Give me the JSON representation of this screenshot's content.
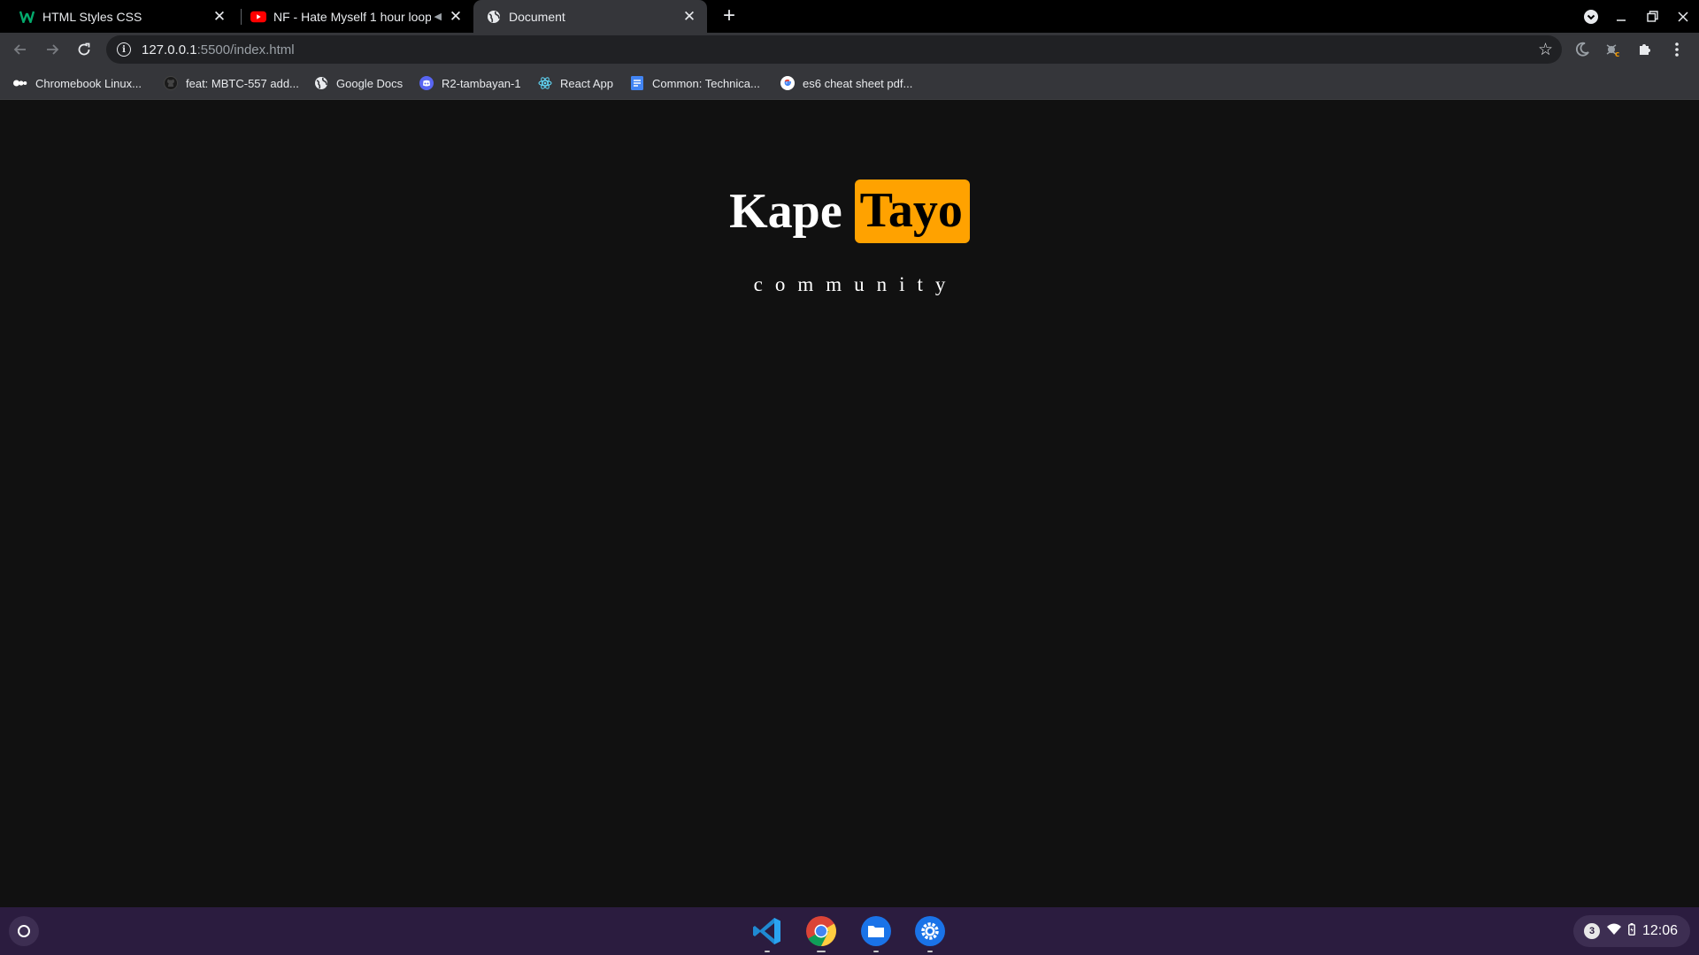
{
  "tabs": [
    {
      "title": "HTML Styles CSS",
      "favicon": "w3schools-icon",
      "active": false
    },
    {
      "title": "NF - Hate Myself 1 hour loop",
      "favicon": "youtube-icon",
      "active": false,
      "muted_indicator": "audio-icon"
    },
    {
      "title": "Document",
      "favicon": "globe-icon",
      "active": true
    }
  ],
  "toolbar": {
    "url_host": "127.0.0.1",
    "url_path": ":5500/index.html"
  },
  "bookmarks": [
    {
      "label": "Chromebook Linux...",
      "icon": "video-icon"
    },
    {
      "label": "feat: MBTC-557 add...",
      "icon": "github-icon"
    },
    {
      "label": "Google Docs",
      "icon": "globe-icon"
    },
    {
      "label": "R2-tambayan-1",
      "icon": "discord-icon"
    },
    {
      "label": "React App",
      "icon": "react-icon"
    },
    {
      "label": "Common: Technica...",
      "icon": "docs-icon"
    },
    {
      "label": "es6 cheat sheet pdf...",
      "icon": "google-icon"
    }
  ],
  "page": {
    "brand_word1": "Kape",
    "brand_word2": "Tayo",
    "tagline": "community",
    "accent_color": "#ffa200",
    "background_color": "#111111"
  },
  "shelf": {
    "apps": [
      "vscode-icon",
      "chrome-icon",
      "files-icon",
      "settings-icon"
    ],
    "notification_count": "3",
    "time": "12:06"
  }
}
